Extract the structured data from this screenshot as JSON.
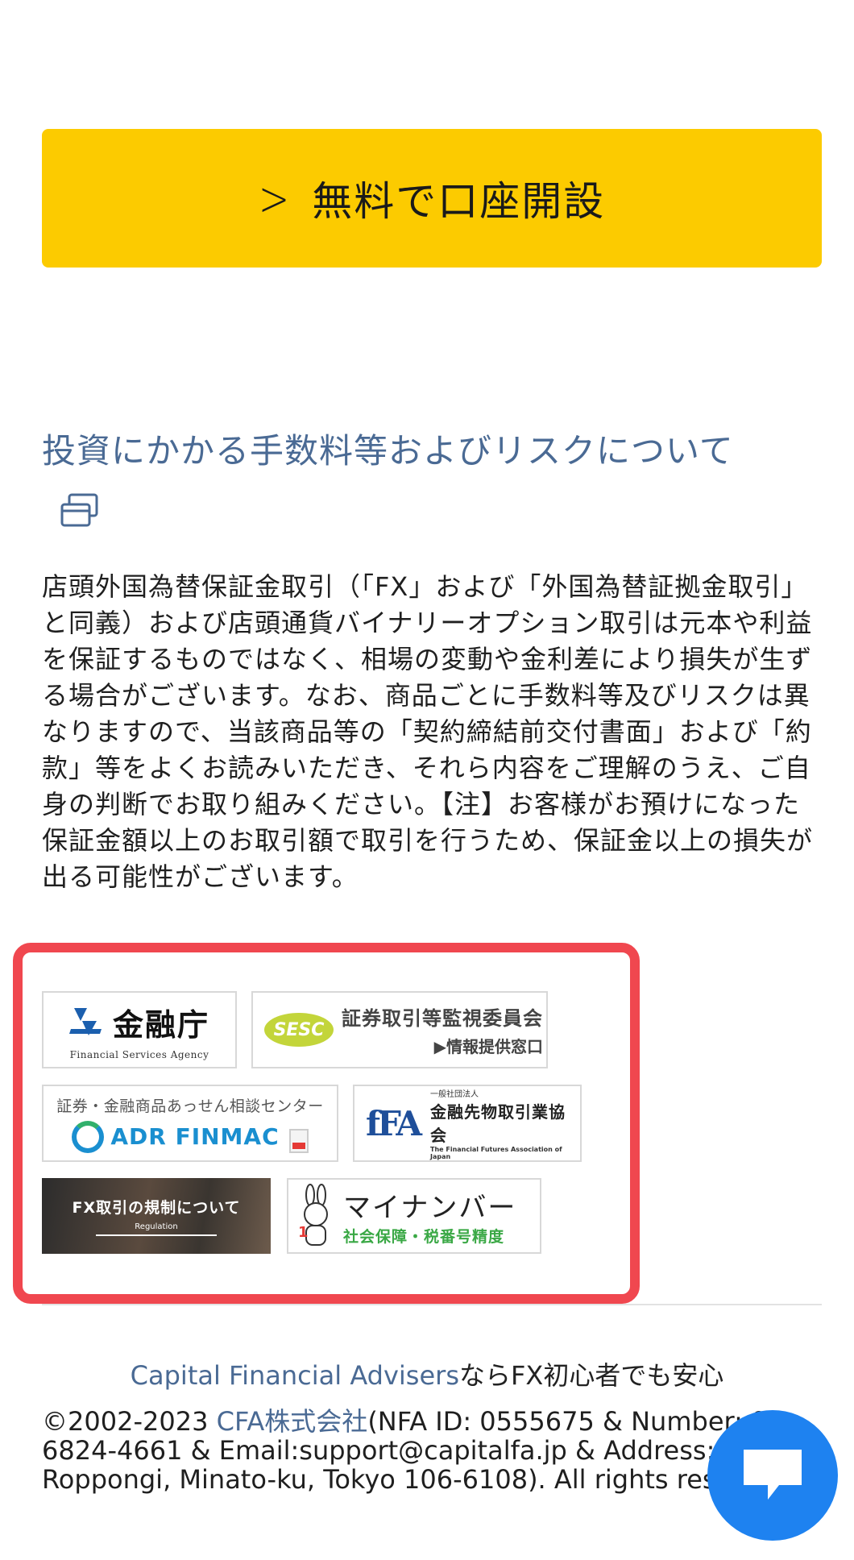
{
  "cta": {
    "chevron": ">",
    "label": "無料で口座開設"
  },
  "risk": {
    "title": "投資にかかる手数料等およびリスクについて",
    "body": "店頭外国為替保証金取引（「FX」および「外国為替証拠金取引」と同義）および店頭通貨バイナリーオプション取引は元本や利益を保証するものではなく、相場の変動や金利差により損失が生ずる場合がございます。なお、商品ごとに手数料等及びリスクは異なりますので、当該商品等の「契約締結前交付書面」および「約款」等をよくお読みいただき、それら内容をご理解のうえ、ご自身の判断でお取り組みください。【注】お客様がお預けになった保証金額以上のお取引額で取引を行うため、保証金以上の損失が出る可能性がございます。"
  },
  "banners": {
    "fsa": {
      "title": "金融庁",
      "subtitle": "Financial Services Agency"
    },
    "sesc": {
      "badge": "SESC",
      "title": "証券取引等監視委員会",
      "subtitle": "▶情報提供窓口"
    },
    "adr": {
      "top": "証券・金融商品あっせん相談センター",
      "name": "ADR FINMAC"
    },
    "ffaj": {
      "mark": "fFA",
      "small": "一般社団法人",
      "title": "金融先物取引業協会",
      "english": "The Financial Futures Association of Japan"
    },
    "fxreg": {
      "title": "FX取引の規制について",
      "subtitle": "Regulation"
    },
    "mynumber": {
      "title": "マイナンバー",
      "subtitle": "社会保障・税番号精度"
    }
  },
  "footer": {
    "tagline_link": "Capital Financial Advisers",
    "tagline_rest": "ならFX初心者でも安心",
    "copyright_prefix": "©2002-2023 ",
    "company_link": "CFA株式会社",
    "copyright_rest": "(NFA ID: 0555675 & Number: 03-6824-4661 & Email:support@capitalfa.jp & Address: 1, Roppongi, Minato-ku, Tokyo 106-6108). All rights reserved."
  },
  "colors": {
    "accent_yellow": "#fccb00",
    "heading_blue": "#4a6a94",
    "highlight_red": "#f0474f",
    "chat_blue": "#1e82f0"
  },
  "icons": [
    "chevron-right-icon",
    "new-window-icon",
    "chat-bubble-icon",
    "pdf-icon"
  ]
}
